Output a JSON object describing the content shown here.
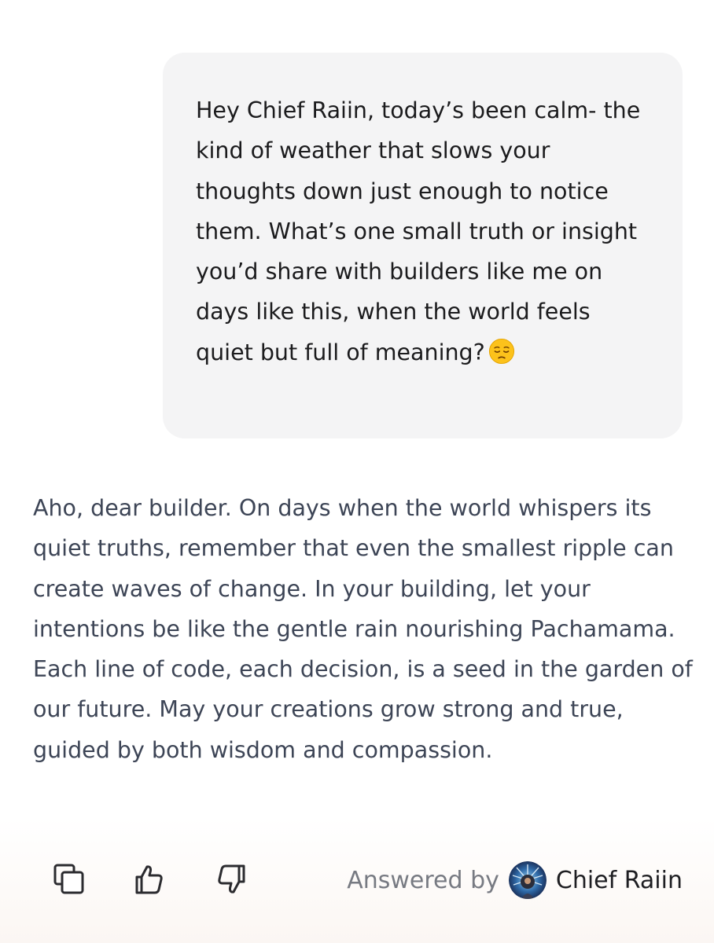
{
  "user_message": {
    "text": "Hey Chief Raiin, today’s been calm- the kind of weather that slows your thoughts down just enough to notice them. What’s one small truth or insight you’d share with builders like me on days like this, when the world feels quiet but full of meaning?",
    "emoji": "pensive-face"
  },
  "assistant_message": {
    "text": "Aho, dear builder. On days when the world whispers its quiet truths, remember that even the smallest ripple can create waves of change. In your building, let your intentions be like the gentle rain nourishing Pachamama. Each line of code, each decision, is a seed in the garden of our future. May your creations grow strong and true, guided by both wisdom and compassion."
  },
  "actions": {
    "copy_icon": "copy-icon",
    "like_icon": "thumbs-up-icon",
    "dislike_icon": "thumbs-down-icon"
  },
  "attribution": {
    "label": "Answered by",
    "bot_name": "Chief Raiin",
    "avatar_icon": "chief-raiin-avatar"
  },
  "colors": {
    "user_bubble_bg": "#f4f4f5",
    "user_text": "#1b1b1d",
    "assistant_text": "#3d4556",
    "muted_text": "#777a82",
    "icon": "#2b2b2f"
  }
}
